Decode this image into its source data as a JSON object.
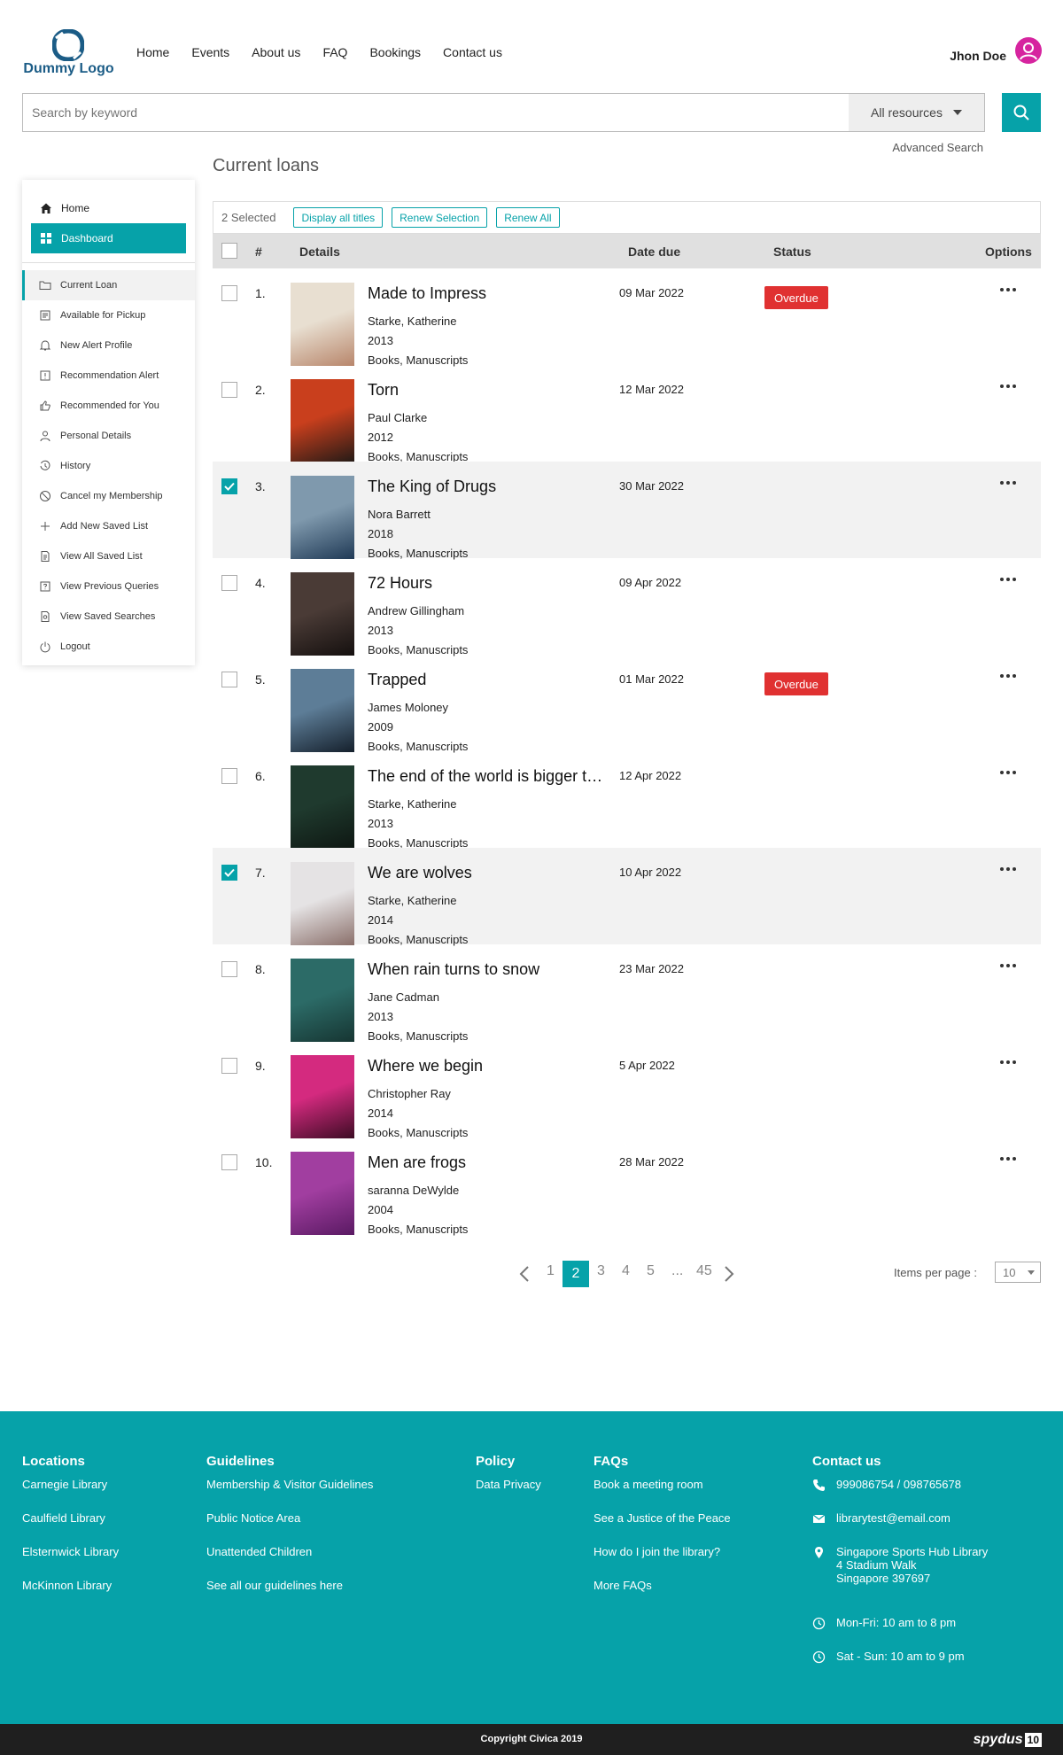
{
  "header": {
    "logo_text": "Dummy Logo",
    "nav": [
      "Home",
      "Events",
      "About us",
      "FAQ",
      "Bookings",
      "Contact us"
    ],
    "user_name": "Jhon Doe"
  },
  "search": {
    "placeholder": "Search by keyword",
    "resource_filter": "All resources",
    "advanced_link": "Advanced Search"
  },
  "sidebar": {
    "top": [
      {
        "label": "Home",
        "icon": "home-icon",
        "active": false
      },
      {
        "label": "Dashboard",
        "icon": "dashboard-icon",
        "active": true
      }
    ],
    "items": [
      {
        "label": "Current Loan",
        "icon": "folder-icon",
        "selected": true
      },
      {
        "label": "Available for Pickup",
        "icon": "pickup-icon"
      },
      {
        "label": "New Alert Profile",
        "icon": "bell-icon"
      },
      {
        "label": "Recommendation Alert",
        "icon": "alert-icon"
      },
      {
        "label": "Recommended for You",
        "icon": "thumbs-up-icon"
      },
      {
        "label": "Personal Details",
        "icon": "user-icon"
      },
      {
        "label": "History",
        "icon": "history-icon"
      },
      {
        "label": "Cancel my Membership",
        "icon": "cancel-icon"
      },
      {
        "label": "Add New Saved List",
        "icon": "plus-icon"
      },
      {
        "label": "View All Saved List",
        "icon": "document-icon"
      },
      {
        "label": "View Previous Queries",
        "icon": "question-icon"
      },
      {
        "label": "View Saved Searches",
        "icon": "saved-search-icon"
      },
      {
        "label": "Logout",
        "icon": "power-icon"
      }
    ]
  },
  "page_title": "Current loans",
  "toolbar": {
    "selected_count": "2 Selected",
    "display_all": "Display all titles",
    "renew_selection": "Renew Selection",
    "renew_all": "Renew All"
  },
  "table": {
    "headers": {
      "num": "#",
      "details": "Details",
      "date": "Date due",
      "status": "Status",
      "options": "Options"
    },
    "rows": [
      {
        "num": "1.",
        "title": "Made to Impress",
        "author": "Starke, Katherine",
        "year": "2013",
        "type": "Books, Manuscripts",
        "due": "09 Mar 2022",
        "status": "Overdue",
        "checked": false,
        "cover": "#e8dfd1",
        "cover2": "#b8866b"
      },
      {
        "num": "2.",
        "title": "Torn",
        "author": "Paul Clarke",
        "year": "2012",
        "type": "Books, Manuscripts",
        "due": "12 Mar 2022",
        "status": "",
        "checked": false,
        "cover": "#c93f1d",
        "cover2": "#231a16"
      },
      {
        "num": "3.",
        "title": "The King of Drugs",
        "author": "Nora Barrett",
        "year": "2018",
        "type": "Books, Manuscripts",
        "due": "30 Mar 2022",
        "status": "",
        "checked": true,
        "cover": "#7f99ad",
        "cover2": "#203a56"
      },
      {
        "num": "4.",
        "title": "72 Hours",
        "author": "Andrew Gillingham",
        "year": "2013",
        "type": "Books, Manuscripts",
        "due": "09 Apr 2022",
        "status": "",
        "checked": false,
        "cover": "#4a3b36",
        "cover2": "#15100f"
      },
      {
        "num": "5.",
        "title": "Trapped",
        "author": "James Moloney",
        "year": "2009",
        "type": "Books, Manuscripts",
        "due": "01 Mar 2022",
        "status": "Overdue",
        "checked": false,
        "cover": "#5d7d97",
        "cover2": "#15202c"
      },
      {
        "num": "6.",
        "title": "The end of the world is bigger than love",
        "author": "Starke, Katherine",
        "year": "2013",
        "type": "Books, Manuscripts",
        "due": "12 Apr 2022",
        "status": "",
        "checked": false,
        "cover": "#1f3a2e",
        "cover2": "#0e1712"
      },
      {
        "num": "7.",
        "title": "We are wolves",
        "author": "Starke, Katherine",
        "year": "2014",
        "type": "Books, Manuscripts",
        "due": "10 Apr 2022",
        "status": "",
        "checked": true,
        "cover": "#e5e3e4",
        "cover2": "#8a6f6a"
      },
      {
        "num": "8.",
        "title": "When rain turns to snow",
        "author": "Jane Cadman",
        "year": "2013",
        "type": "Books, Manuscripts",
        "due": "23 Mar 2022",
        "status": "",
        "checked": false,
        "cover": "#2c6b67",
        "cover2": "#163532"
      },
      {
        "num": "9.",
        "title": "Where we begin",
        "author": "Christopher Ray",
        "year": "2014",
        "type": "Books, Manuscripts",
        "due": "5 Apr 2022",
        "status": "",
        "checked": false,
        "cover": "#d42a7f",
        "cover2": "#3d0c24"
      },
      {
        "num": "10.",
        "title": "Men are frogs",
        "author": "saranna DeWylde",
        "year": "2004",
        "type": "Books, Manuscripts",
        "due": "28 Mar 2022",
        "status": "",
        "checked": false,
        "cover": "#a13ea0",
        "cover2": "#5a1a63"
      }
    ]
  },
  "pagination": {
    "pages": [
      "1",
      "2",
      "3",
      "4",
      "5",
      "...",
      "45"
    ],
    "current": "2",
    "items_label": "Items per page :",
    "items_value": "10"
  },
  "footer": {
    "locations": {
      "title": "Locations",
      "links": [
        "Carnegie Library",
        "Caulfield Library",
        "Elsternwick Library",
        "McKinnon Library"
      ]
    },
    "guidelines": {
      "title": "Guidelines",
      "links": [
        "Membership & Visitor Guidelines",
        "Public Notice Area",
        "Unattended Children",
        "See all our guidelines here"
      ]
    },
    "policy": {
      "title": "Policy",
      "links": [
        "Data Privacy"
      ]
    },
    "faqs": {
      "title": "FAQs",
      "links": [
        "Book a meeting room",
        "See a Justice of the Peace",
        "How do I join the library?",
        "More FAQs"
      ]
    },
    "contact": {
      "title": "Contact us",
      "phone": "999086754 / 098765678",
      "email": "librarytest@email.com",
      "address": [
        "Singapore Sports Hub Library",
        "4 Stadium Walk",
        "Singapore 397697"
      ],
      "hours1": "Mon-Fri: 10 am to 8 pm",
      "hours2": "Sat - Sun: 10 am to 9 pm"
    },
    "copyright": "Copyright Civica 2019",
    "brand": "spydus",
    "brand_num": "10"
  },
  "colors": {
    "accent": "#06a2a9",
    "overdue": "#e03131",
    "avatar": "#d6249f"
  }
}
